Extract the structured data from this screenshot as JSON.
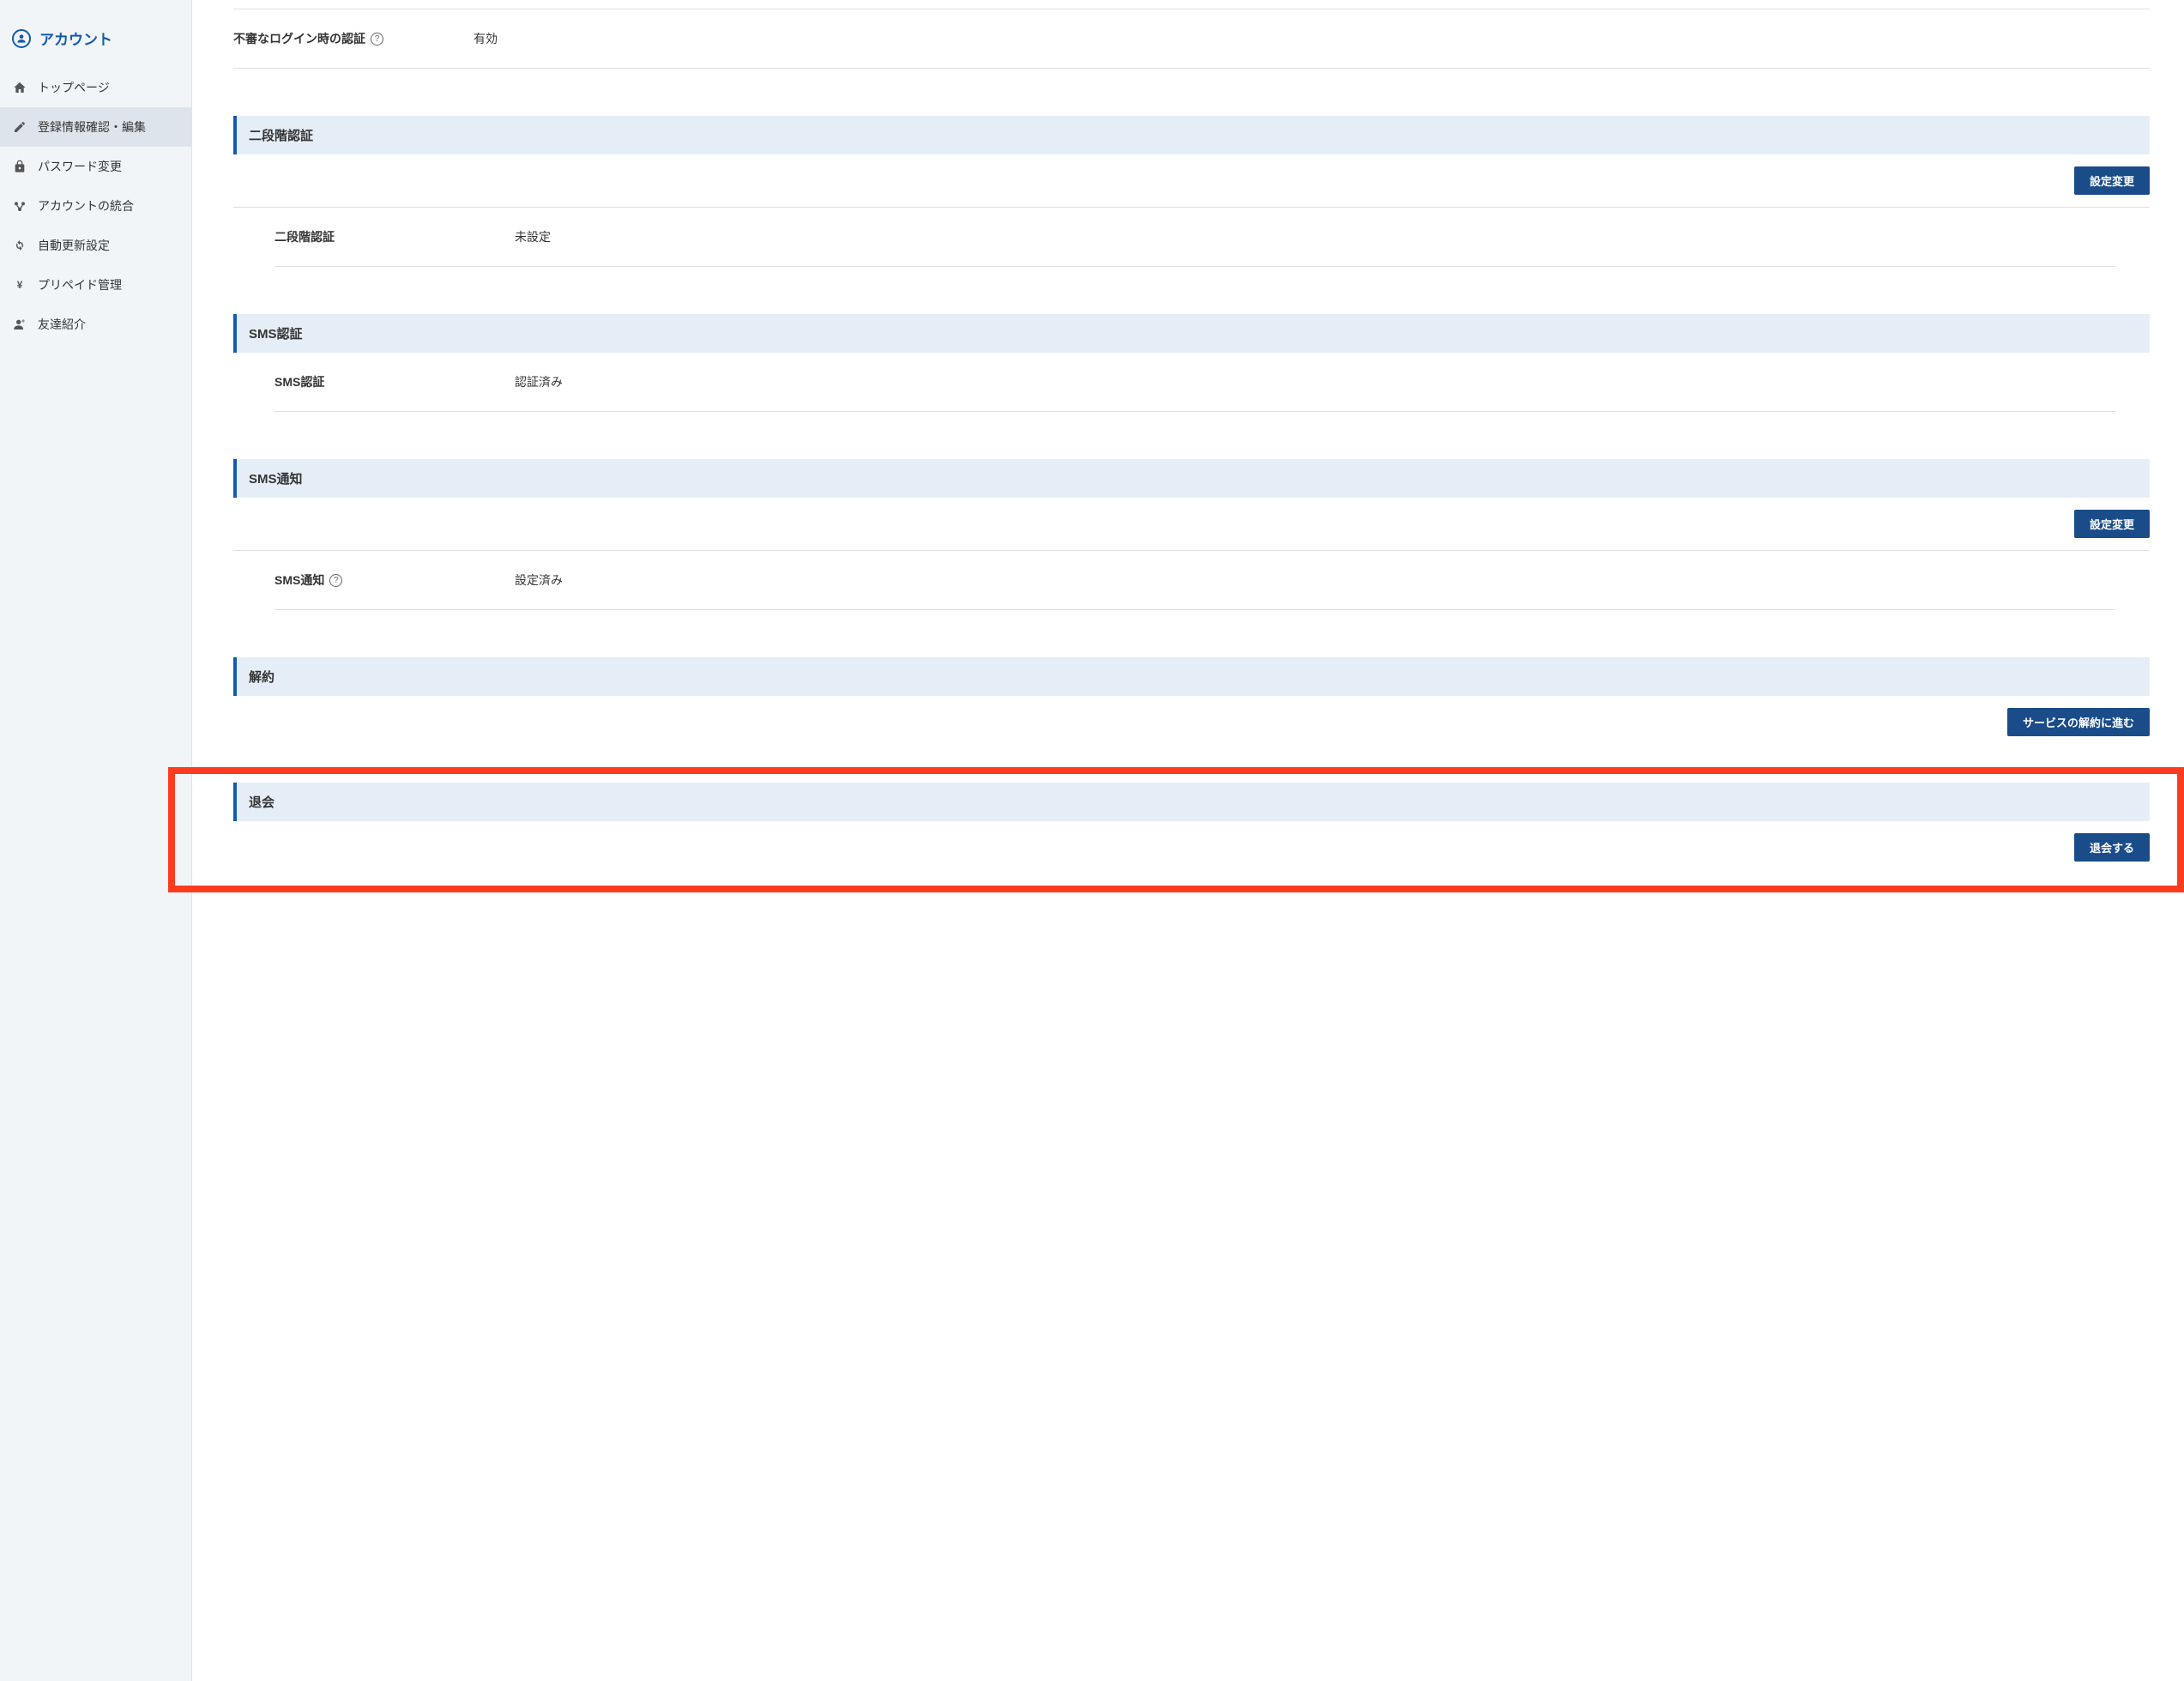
{
  "sidebar": {
    "title": "アカウント",
    "items": [
      {
        "label": "トップページ",
        "icon": "home-icon",
        "active": false
      },
      {
        "label": "登録情報確認・編集",
        "icon": "edit-icon",
        "active": true
      },
      {
        "label": "パスワード変更",
        "icon": "lock-icon",
        "active": false
      },
      {
        "label": "アカウントの統合",
        "icon": "merge-icon",
        "active": false
      },
      {
        "label": "自動更新設定",
        "icon": "refresh-icon",
        "active": false
      },
      {
        "label": "プリペイド管理",
        "icon": "yen-icon",
        "active": false
      },
      {
        "label": "友達紹介",
        "icon": "person-icon",
        "active": false
      }
    ]
  },
  "main": {
    "suspicious_login": {
      "label": "不審なログイン時の認証",
      "value": "有効"
    },
    "two_factor": {
      "heading": "二段階認証",
      "button": "設定変更",
      "row_label": "二段階認証",
      "row_value": "未設定"
    },
    "sms_auth": {
      "heading": "SMS認証",
      "row_label": "SMS認証",
      "row_value": "認証済み"
    },
    "sms_notify": {
      "heading": "SMS通知",
      "button": "設定変更",
      "row_label": "SMS通知",
      "row_value": "設定済み"
    },
    "cancel": {
      "heading": "解約",
      "button": "サービスの解約に進む"
    },
    "withdraw": {
      "heading": "退会",
      "button": "退会する"
    }
  }
}
